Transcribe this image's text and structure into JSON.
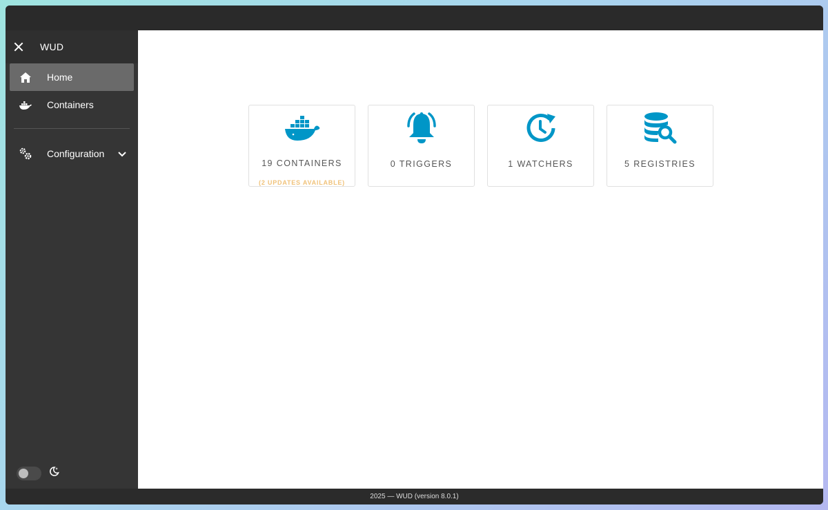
{
  "app": {
    "title": "WUD"
  },
  "sidebar": {
    "items": [
      {
        "label": "Home",
        "icon": "home-icon",
        "active": true
      },
      {
        "label": "Containers",
        "icon": "docker-icon",
        "active": false
      },
      {
        "label": "Configuration",
        "icon": "gears-icon",
        "active": false,
        "expandable": true
      }
    ]
  },
  "cards": [
    {
      "label": "19 CONTAINERS",
      "sublabel": "(2 UPDATES AVAILABLE)",
      "icon": "docker-whale-icon"
    },
    {
      "label": "0 TRIGGERS",
      "icon": "bell-icon"
    },
    {
      "label": "1 WATCHERS",
      "icon": "clock-refresh-icon"
    },
    {
      "label": "5 REGISTRIES",
      "icon": "database-search-icon"
    }
  ],
  "footer": {
    "text": "2025 — WUD (version 8.0.1)"
  },
  "colors": {
    "accent": "#0096c7",
    "warning": "#f0c27a",
    "sidebar_bg": "#353535",
    "active_bg": "#6a6a6a"
  }
}
